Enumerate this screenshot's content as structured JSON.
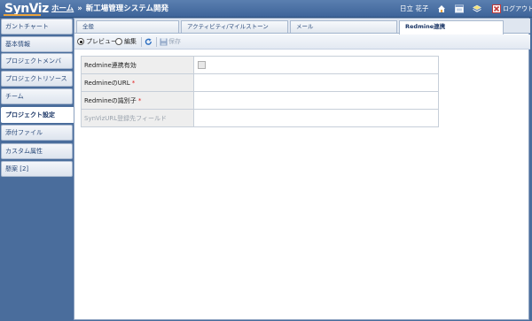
{
  "header": {
    "logo": "SynViz",
    "home_link": "ホーム",
    "separator": "»",
    "title": "新工場管理システム開発",
    "user_name": "日立 花子",
    "logout_label": "ログアウト"
  },
  "sidebar": {
    "items": [
      {
        "label": "ガントチャート",
        "active": false
      },
      {
        "label": "基本情報",
        "active": false
      },
      {
        "label": "プロジェクトメンバ",
        "active": false
      },
      {
        "label": "プロジェクトリソース",
        "active": false
      },
      {
        "label": "チーム",
        "active": false
      },
      {
        "label": "プロジェクト設定",
        "active": true
      },
      {
        "label": "添付ファイル",
        "active": false
      },
      {
        "label": "カスタム属性",
        "active": false
      },
      {
        "label": "懸案 [2]",
        "active": false
      }
    ]
  },
  "tabs": [
    {
      "label": "全般",
      "active": false
    },
    {
      "label": "アクティビティ/マイルストーン",
      "active": false
    },
    {
      "label": "メール",
      "active": false
    },
    {
      "label": "Redmine連携",
      "active": true
    }
  ],
  "toolbar": {
    "preview_label": "プレビュー",
    "edit_label": "編集",
    "save_label": "保存",
    "mode": "preview"
  },
  "form": {
    "rows": [
      {
        "label": "Redmine連携有効",
        "required": false,
        "type": "checkbox",
        "value": ""
      },
      {
        "label": "RedmineのURL",
        "required": true,
        "type": "text",
        "value": ""
      },
      {
        "label": "Redmineの識別子",
        "required": true,
        "type": "text",
        "value": ""
      },
      {
        "label": "SynVizURL登録先フィールド",
        "required": false,
        "type": "text",
        "value": "",
        "disabled": true
      }
    ],
    "required_mark": "*"
  }
}
